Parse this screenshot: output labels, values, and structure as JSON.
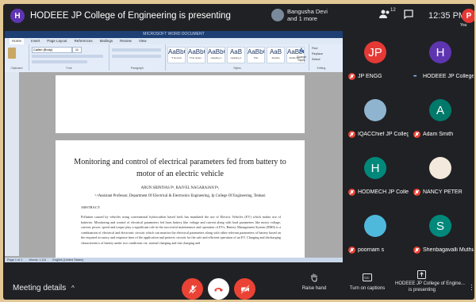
{
  "topbar": {
    "presenter_initial": "H",
    "presenting_title": "HODEEE JP College of Engineering is presenting",
    "viewers_line1": "Bangusha Devi",
    "viewers_line2": "and 1 more",
    "participants_count": "12",
    "clock": "12:35 PM",
    "self_initial": "P",
    "self_label": "You"
  },
  "word": {
    "window_title": "MICROSOFT WORD DOCUMENT",
    "tabs": [
      "Home",
      "Insert",
      "Page Layout",
      "References",
      "Mailings",
      "Review",
      "View"
    ],
    "font_name": "Calibri (Body)",
    "font_size": "11",
    "group_labels": [
      "Clipboard",
      "Font",
      "Paragraph",
      "Styles",
      "Editing"
    ],
    "styles": [
      {
        "preview": "AaBbCcDc",
        "name": "¶ Normal"
      },
      {
        "preview": "AaBbCcDc",
        "name": "¶ No Spaci..."
      },
      {
        "preview": "AaBbCc",
        "name": "Heading 1"
      },
      {
        "preview": "AaB",
        "name": "Heading 2"
      },
      {
        "preview": "AaBbCc",
        "name": "Title"
      },
      {
        "preview": "AaB",
        "name": "Subtitle"
      },
      {
        "preview": "AaBbCcDc",
        "name": "Subtle Em..."
      }
    ],
    "change_styles": "Change Styles",
    "editing_items": [
      "Find",
      "Replace",
      "Select"
    ],
    "status_page": "Page 1 of 1",
    "status_words": "Words: 1,111",
    "status_lang": "English (United States)"
  },
  "paper": {
    "title_line1": "Monitoring and control of electrical parameters fed from battery to",
    "title_line2": "motor of an electric vehicle",
    "authors": "ARUN SRINIVAS P¹, RAJVEL NAGARAJAN P²,",
    "affiliation": "¹˒²Assistant Professor, Department Of Electrical & Electronics Engineering, Jp College Of Engineering, Tenkasi",
    "abstract_heading": "ABSTRACT:",
    "abstract_text": "Pollution caused by vehicles using conventional hydrocarbon based fuels has mandated the use of Electric Vehicles (EV) which makes use of batteries. Monitoring and control of electrical parameters fed from battery like voltage and current along with load parameters like motor voltage, current, power, speed and torque play a significant role in the successful maintenance and operation of EVs. Battery Management System (BMS) is a combination of electrical and electronic circuits which can monitor the electrical parameters along with other relevant parameters of battery based on the required accuracy and response time of the application and protects circuits for the safe and efficient operation of an EV. Charging and discharging characteristics of battery under two conditions viz. normal charging and fast charging and"
  },
  "participants": [
    {
      "initial": "JP",
      "name": "JP ENGG",
      "color": "#e53935",
      "muted": true
    },
    {
      "initial": "H",
      "name": "HODEEE JP College of",
      "color": "#5e35b1",
      "muted": false
    },
    {
      "initial": "",
      "name": "IQACChief JP College ...",
      "color": "#8fb4cf",
      "muted": true
    },
    {
      "initial": "A",
      "name": "Adam Smith",
      "color": "#00796b",
      "muted": true
    },
    {
      "initial": "H",
      "name": "HODMECH JP College ...",
      "color": "#00897b",
      "muted": true
    },
    {
      "initial": "",
      "name": "NANCY PETER",
      "color": "#f3e9dc",
      "muted": true
    },
    {
      "initial": "",
      "name": "poornam s",
      "color": "#4fb9dc",
      "muted": true
    },
    {
      "initial": "S",
      "name": "Shenbagavalli Muthia...",
      "color": "#00897b",
      "muted": true
    }
  ],
  "bottom": {
    "meeting_details": "Meeting details",
    "raise_hand": "Raise hand",
    "captions": "Turn on captions",
    "presenting_line1": "HODEEE JP College of Engine...",
    "presenting_line2": "is presenting"
  },
  "colors": {
    "background": "#202124",
    "accent_red": "#ea4335",
    "outer_frame": "#e2c896"
  }
}
